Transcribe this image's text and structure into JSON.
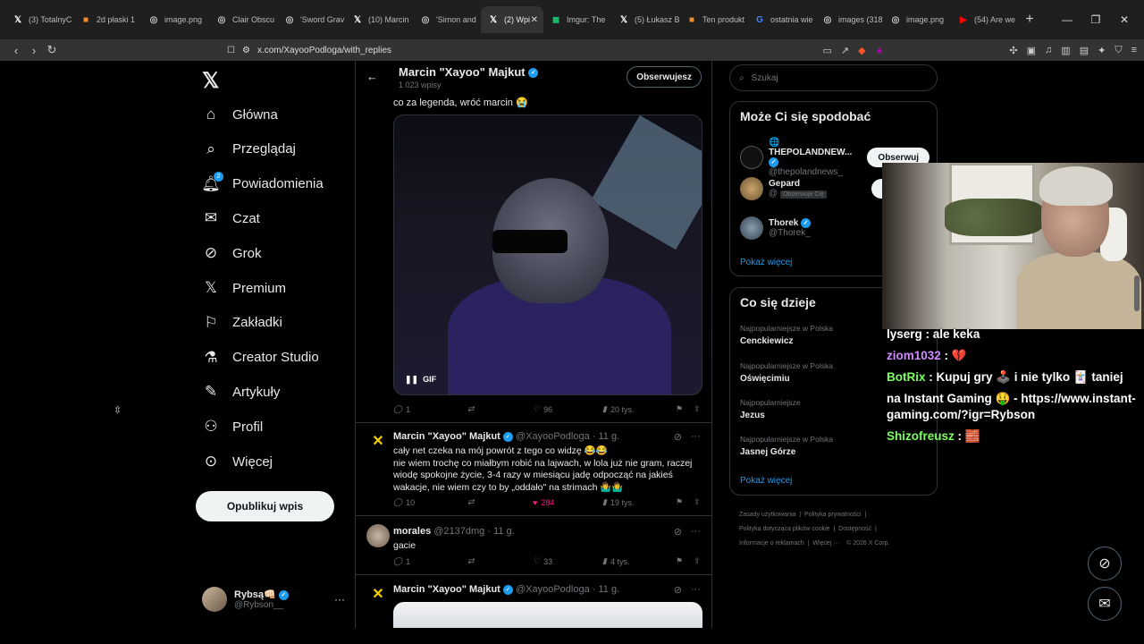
{
  "browser": {
    "tabs": [
      {
        "label": "(3) TotalnyC",
        "icon": "x-icon",
        "color": "#ffffff"
      },
      {
        "label": "2d płaski 1 ",
        "icon": "orange-app-icon",
        "color": "#f28d2b"
      },
      {
        "label": "image.png",
        "icon": "globe-icon",
        "color": "#cccccc"
      },
      {
        "label": "Clair Obscu",
        "icon": "globe-icon",
        "color": "#cccccc"
      },
      {
        "label": "'Sword Grav",
        "icon": "globe-icon",
        "color": "#cccccc"
      },
      {
        "label": "(10) Marcin",
        "icon": "x-icon",
        "color": "#ffffff"
      },
      {
        "label": "'Simon and",
        "icon": "globe-icon",
        "color": "#cccccc"
      },
      {
        "label": "(2) Wpi",
        "icon": "x-icon",
        "color": "#ffffff",
        "active": true
      },
      {
        "label": "Imgur: The",
        "icon": "imgur-icon",
        "color": "#1bb76e"
      },
      {
        "label": "(5) Łukasz B",
        "icon": "x-icon",
        "color": "#ffffff"
      },
      {
        "label": "Ten produkt",
        "icon": "orange-app-icon",
        "color": "#f28d2b"
      },
      {
        "label": "ostatnia wie",
        "icon": "google-icon",
        "color": "#4285f4"
      },
      {
        "label": "images (318",
        "icon": "globe-icon",
        "color": "#cccccc"
      },
      {
        "label": "image.png",
        "icon": "globe-icon",
        "color": "#cccccc"
      },
      {
        "label": "(54) Are we",
        "icon": "youtube-icon",
        "color": "#ff0000"
      }
    ],
    "url": "x.com/XayooPodloga/with_replies"
  },
  "sidebar": {
    "items": [
      {
        "label": "Główna",
        "icon": "home-icon"
      },
      {
        "label": "Przeglądaj",
        "icon": "search-icon"
      },
      {
        "label": "Powiadomienia",
        "icon": "bell-icon",
        "badge": "2"
      },
      {
        "label": "Czat",
        "icon": "mail-icon"
      },
      {
        "label": "Grok",
        "icon": "grok-icon"
      },
      {
        "label": "Premium",
        "icon": "x-icon"
      },
      {
        "label": "Zakładki",
        "icon": "bookmark-icon"
      },
      {
        "label": "Creator Studio",
        "icon": "flask-icon"
      },
      {
        "label": "Artykuły",
        "icon": "article-icon"
      },
      {
        "label": "Profil",
        "icon": "person-icon"
      },
      {
        "label": "Więcej",
        "icon": "more-circle-icon"
      }
    ],
    "post_button": "Opublikuj wpis",
    "user": {
      "name": "Rybsą",
      "emoji": "👊🏻",
      "handle": "@Rybson__"
    }
  },
  "profile_header": {
    "name": "Marcin \"Xayoo\" Majkut",
    "post_count": "1 023 wpisy",
    "follow_button": "Obserwujesz"
  },
  "tweets": {
    "reply_text": "co za legenda, wróć marcin 😭",
    "gif_label": "GIF",
    "gif_actions": {
      "replies": "1",
      "reposts": "",
      "likes": "96",
      "views": "20 tys."
    },
    "t1": {
      "name": "Marcin \"Xayoo\" Majkut",
      "handle": "@XayooPodloga · 11 g.",
      "text": "cały net czeka na mój powrót z tego co widzę 😂😂\nnie wiem trochę co miałbym robić na lajwach, w lola już nie gram, raczej wiodę spokojne życie, 3-4 razy w miesiącu jadę odpocząć na jakieś wakacje, nie wiem czy to by „oddało\" na strimach 🤷‍♂️🤷‍♂️",
      "replies": "10",
      "reposts": "",
      "likes": "284",
      "views": "19 tys."
    },
    "t2": {
      "name": "morales",
      "handle": "@2137dmg · 11 g.",
      "text": "gacie",
      "replies": "1",
      "reposts": "",
      "likes": "33",
      "views": "4 tys."
    },
    "t3": {
      "name": "Marcin \"Xayoo\" Majkut",
      "handle": "@XayooPodloga · 11 g."
    }
  },
  "right": {
    "search_placeholder": "Szukaj",
    "wtf_title": "Może Ci się spodobać",
    "wtf": [
      {
        "name": "THEPOLANDNEW...",
        "handle": "@thepolandnews_",
        "button": "Obserwuj"
      },
      {
        "name": "Gepard",
        "handle": "@",
        "follows_you": "Obserwuje Cię",
        "button": "Również"
      },
      {
        "name": "Thorek",
        "handle": "@Thorek_",
        "button": "O"
      }
    ],
    "show_more": "Pokaż więcej",
    "trends_title": "Co się dzieje",
    "trends": [
      {
        "context": "Najpopularniejsze w Polska",
        "name": "Cenckiewicz"
      },
      {
        "context": "Najpopularniejsze w Polska",
        "name": "Oświęcimiu"
      },
      {
        "context": "Najpopularniejsze",
        "name": "Jezus"
      },
      {
        "context": "Najpopularniejsze w Polska",
        "name": "Jasnej Górze"
      }
    ],
    "trends_more": "Pokaż więcej",
    "footer": [
      "Zasady użytkowania",
      "Polityka prywatności",
      "Polityka dotycząca plików cookie",
      "Dostępność",
      "Informacje o reklamach",
      "Więcej ···",
      "© 2026 X Corp."
    ]
  },
  "chat": [
    {
      "user": "lyserg",
      "text": " : ale keka",
      "color": "#ffffff"
    },
    {
      "user": "ziom1032",
      "text": " : 💔",
      "color": "#d08bff"
    },
    {
      "user": "BotRix",
      "text": " : Kupuj gry 🕹️ i nie tylko 🃏 taniej",
      "color": "#7cff5f"
    },
    {
      "user": "",
      "text": "na Instant Gaming 🤑 - https://www.instant-",
      "color": "#ffffff"
    },
    {
      "user": "",
      "text": "gaming.com/?igr=Rybson",
      "color": "#ffffff"
    },
    {
      "user": "Shizofreusz",
      "text": " : 🧱",
      "color": "#7cff5f"
    }
  ],
  "colors": {
    "accent": "#1d9bf0",
    "like": "#f91880",
    "bg": "#000000",
    "border": "#2f3336"
  }
}
